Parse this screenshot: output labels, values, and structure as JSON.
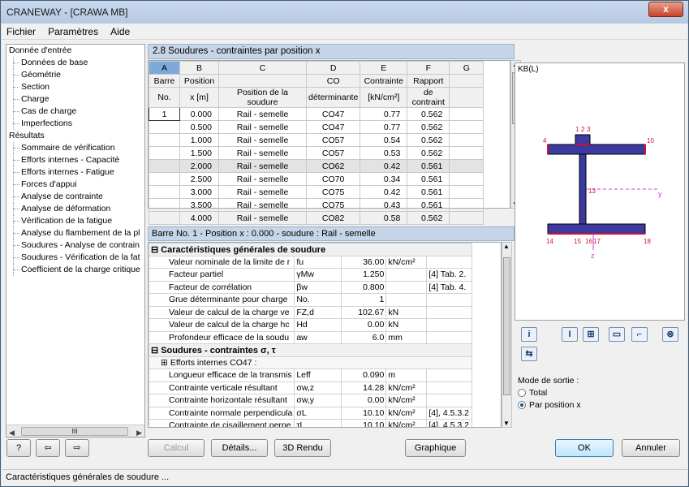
{
  "window": {
    "title": "CRANEWAY - [CRAWA MB]",
    "close": "x"
  },
  "menu": [
    "Fichier",
    "Paramètres",
    "Aide"
  ],
  "tree": [
    {
      "label": "Donnée d'entrée",
      "level": 0
    },
    {
      "label": "Données de base",
      "level": 1
    },
    {
      "label": "Géométrie",
      "level": 1
    },
    {
      "label": "Section",
      "level": 1
    },
    {
      "label": "Charge",
      "level": 1
    },
    {
      "label": "Cas de charge",
      "level": 1
    },
    {
      "label": "Imperfections",
      "level": 1
    },
    {
      "label": "Résultats",
      "level": 0
    },
    {
      "label": "Sommaire de vérification",
      "level": 1
    },
    {
      "label": "Efforts internes - Capacité",
      "level": 1
    },
    {
      "label": "Efforts internes - Fatigue",
      "level": 1
    },
    {
      "label": "Forces d'appui",
      "level": 1
    },
    {
      "label": "Analyse de contrainte",
      "level": 1
    },
    {
      "label": "Analyse de déformation",
      "level": 1
    },
    {
      "label": "Vérification de la fatigue",
      "level": 1
    },
    {
      "label": "Analyse du flambement de la pl",
      "level": 1
    },
    {
      "label": "Soudures - Analyse de contrain",
      "level": 1
    },
    {
      "label": "Soudures - Vérification de la fat",
      "level": 1
    },
    {
      "label": "Coefficient de la charge critique",
      "level": 1
    }
  ],
  "tree_scroll_thumb": "III",
  "panel_title": "2.8 Soudures - contraintes par position x",
  "table1": {
    "col_letters": [
      "A",
      "B",
      "C",
      "D",
      "E",
      "F",
      "G"
    ],
    "headers1": [
      "Barre",
      "Position",
      "",
      "CO",
      "Contrainte",
      "Rapport",
      ""
    ],
    "headers2": [
      "No.",
      "x [m]",
      "Position de la soudure",
      "déterminante",
      "[kN/cm²]",
      "de contraint",
      ""
    ],
    "rows": [
      [
        "1",
        "0.000",
        "Rail - semelle",
        "CO47",
        "0.77",
        "0.562"
      ],
      [
        "",
        "0.500",
        "Rail - semelle",
        "CO47",
        "0.77",
        "0.562"
      ],
      [
        "",
        "1.000",
        "Rail - semelle",
        "CO57",
        "0.54",
        "0.562"
      ],
      [
        "",
        "1.500",
        "Rail - semelle",
        "CO57",
        "0.53",
        "0.562"
      ],
      [
        "",
        "2.000",
        "Rail - semelle",
        "CO62",
        "0.42",
        "0.561"
      ],
      [
        "",
        "2.500",
        "Rail - semelle",
        "CO70",
        "0.34",
        "0.561"
      ],
      [
        "",
        "3.000",
        "Rail - semelle",
        "CO75",
        "0.42",
        "0.561"
      ],
      [
        "",
        "3.500",
        "Rail - semelle",
        "CO75",
        "0.43",
        "0.561"
      ],
      [
        "",
        "4.000",
        "Rail - semelle",
        "CO82",
        "0.58",
        "0.562"
      ]
    ]
  },
  "section_title": "Barre No. 1  -  Position x : 0.000  -  soudure : Rail - semelle",
  "details": [
    {
      "type": "hdr",
      "label": "Caractéristiques générales de soudure",
      "toggle": "⊟"
    },
    {
      "label": "Valeur nominale de la limite de r",
      "sym": "fu",
      "val": "36.00",
      "unit": "kN/cm²",
      "ref": ""
    },
    {
      "label": "Facteur partiel",
      "sym": "γMw",
      "val": "1.250",
      "unit": "",
      "ref": "[4] Tab. 2."
    },
    {
      "label": "Facteur de corrélation",
      "sym": "βw",
      "val": "0.800",
      "unit": "",
      "ref": "[4] Tab. 4."
    },
    {
      "label": "Grue déterminante pour charge",
      "sym": "No.",
      "val": "1",
      "unit": "",
      "ref": ""
    },
    {
      "label": "Valeur de calcul de la charge ve",
      "sym": "FZ,d",
      "val": "102.67",
      "unit": "kN",
      "ref": ""
    },
    {
      "label": "Valeur de calcul de la charge hc",
      "sym": "Hd",
      "val": "0.00",
      "unit": "kN",
      "ref": ""
    },
    {
      "label": "Profondeur efficace de la soudu",
      "sym": "aw",
      "val": "6.0",
      "unit": "mm",
      "ref": ""
    },
    {
      "type": "hdr",
      "label": "Soudures - contraintes σ, τ",
      "toggle": "⊟"
    },
    {
      "type": "sub",
      "label": "Efforts internes CO47 :",
      "toggle": "⊞"
    },
    {
      "label": "Longueur efficace de la transmis",
      "sym": "Leff",
      "val": "0.090",
      "unit": "m",
      "ref": ""
    },
    {
      "label": "Contrainte verticale résultant",
      "sym": "σw,z",
      "val": "14.28",
      "unit": "kN/cm²",
      "ref": ""
    },
    {
      "label": "Contrainte horizontale résultant",
      "sym": "σw,y",
      "val": "0.00",
      "unit": "kN/cm²",
      "ref": ""
    },
    {
      "label": "Contrainte normale perpendicula",
      "sym": "σL",
      "val": "10.10",
      "unit": "kN/cm²",
      "ref": "[4], 4.5.3.2"
    },
    {
      "label": "Contrainte de cisaillement perpe",
      "sym": "τL",
      "val": "10.10",
      "unit": "kN/cm²",
      "ref": "[4], 4.5.3.2"
    }
  ],
  "graphic": {
    "label": "KB(L)",
    "points": [
      "1",
      "2",
      "3",
      "4",
      "10",
      "13",
      "14",
      "15",
      "16",
      "17",
      "18"
    ],
    "axis_y": "y",
    "axis_z": "z"
  },
  "icons": [
    "info-icon",
    "section-icon",
    "dimensions-icon",
    "table-icon",
    "axes-icon",
    "zoom-icon",
    "export-icon"
  ],
  "mode": {
    "label": "Mode de sortie :",
    "options": [
      "Total",
      "Par position x"
    ],
    "selected": 1
  },
  "buttons": {
    "help": "?",
    "calc": "Calcul",
    "details": "Détails...",
    "render": "3D Rendu",
    "graphic": "Graphique",
    "ok": "OK",
    "cancel": "Annuler"
  },
  "status": "Caractéristiques générales de soudure ...",
  "colors": {
    "accent": "#7fa9d9",
    "section_fill": "#3a3aa0",
    "weld_red": "#d01030"
  }
}
